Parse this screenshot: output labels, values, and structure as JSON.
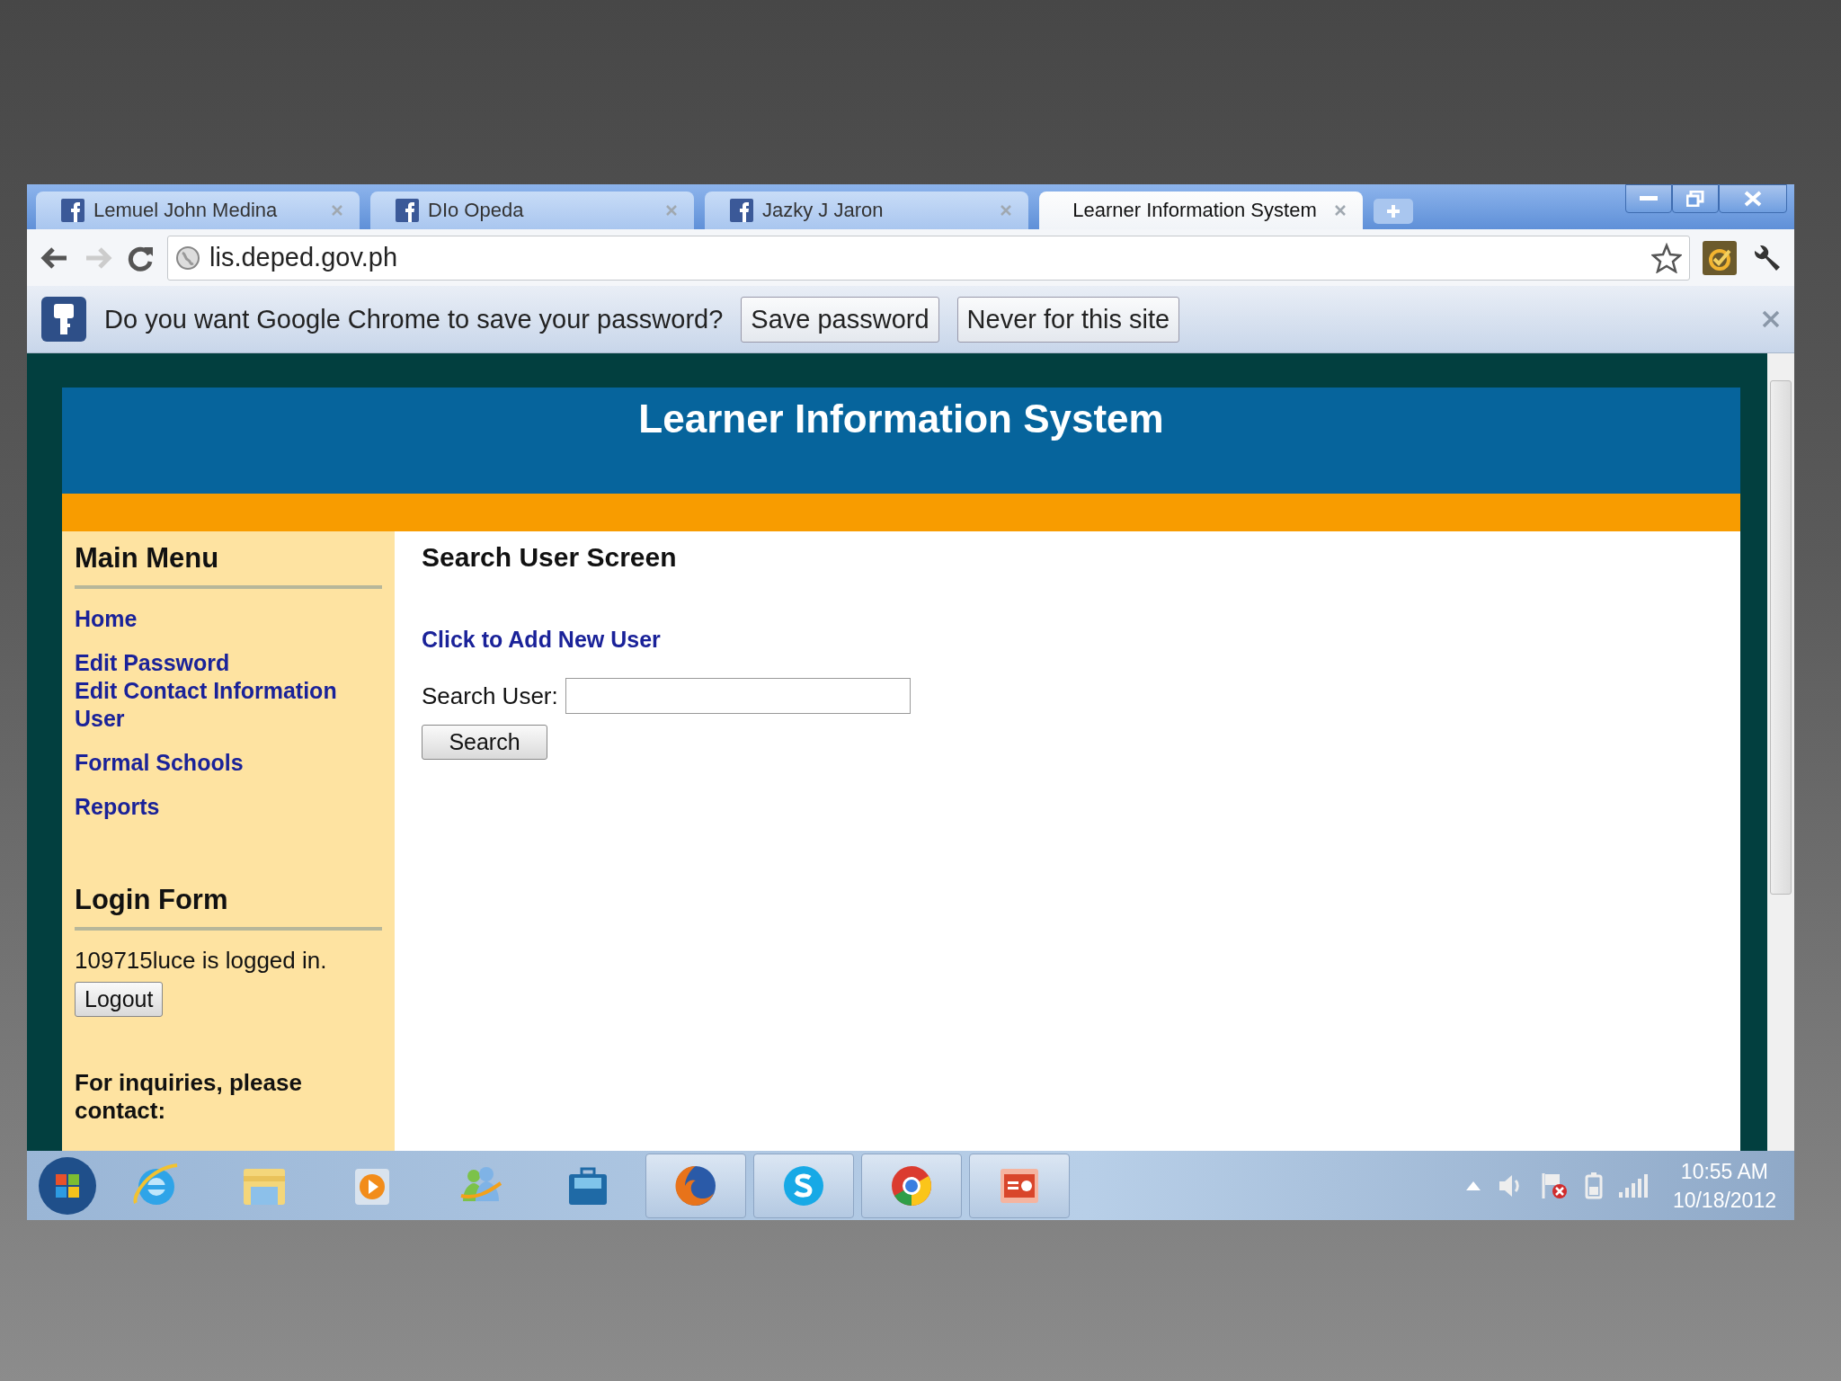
{
  "browser": {
    "tabs": [
      {
        "title": "Lemuel John Medina",
        "kind": "facebook",
        "selected": false
      },
      {
        "title": "DIo Opeda",
        "kind": "facebook",
        "selected": false
      },
      {
        "title": "Jazky J Jaron",
        "kind": "facebook",
        "selected": false
      },
      {
        "title": "Learner Information System",
        "kind": "plain",
        "selected": true
      }
    ],
    "address": "lis.deped.gov.ph",
    "infobar": {
      "message": "Do you want Google Chrome to save your password?",
      "buttons": [
        "Save password",
        "Never for this site"
      ]
    }
  },
  "page": {
    "title": "Learner Information System",
    "sidebar": {
      "menu_heading": "Main Menu",
      "menu_groups": [
        [
          "Home"
        ],
        [
          "Edit Password",
          "Edit Contact Information User"
        ],
        [
          "Formal Schools"
        ],
        [
          "Reports"
        ]
      ],
      "login_heading": "Login Form",
      "login_status": "109715luce is logged in.",
      "logout_button": "Logout",
      "inquiries": "For inquiries, please contact:"
    },
    "main": {
      "heading": "Search User Screen",
      "add_link": "Click to Add New User",
      "search_label": "Search User:",
      "search_button": "Search"
    }
  },
  "taskbar": {
    "apps": [
      {
        "kind": "ie",
        "running": false
      },
      {
        "kind": "folder",
        "running": false
      },
      {
        "kind": "media",
        "running": false
      },
      {
        "kind": "messenger",
        "running": false
      },
      {
        "kind": "briefcase",
        "running": false
      },
      {
        "kind": "firefox",
        "running": true
      },
      {
        "kind": "skype",
        "running": true
      },
      {
        "kind": "chrome",
        "running": true
      },
      {
        "kind": "powerpoint",
        "running": true
      }
    ],
    "time": "10:55 AM",
    "date": "10/18/2012"
  }
}
